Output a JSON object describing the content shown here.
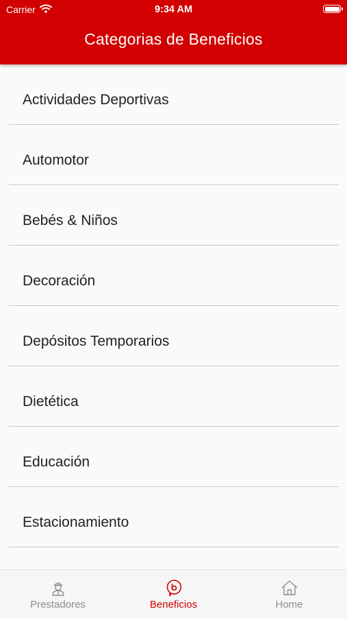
{
  "status_bar": {
    "carrier": "Carrier",
    "time": "9:34 AM"
  },
  "header": {
    "title": "Categorias de Beneficios"
  },
  "categories": [
    "Actividades Deportivas",
    "Automotor",
    "Bebés & Niños",
    "Decoración",
    "Depósitos Temporarios",
    "Dietética",
    "Educación",
    "Estacionamiento"
  ],
  "tabs": [
    {
      "label": "Prestadores",
      "icon": "person-icon",
      "active": false
    },
    {
      "label": "Beneficios",
      "icon": "beneficios-icon",
      "active": true
    },
    {
      "label": "Home",
      "icon": "home-icon",
      "active": false
    }
  ],
  "colors": {
    "accent": "#d20000",
    "inactive": "#8d8d8d",
    "divider": "#c8c8c8"
  }
}
